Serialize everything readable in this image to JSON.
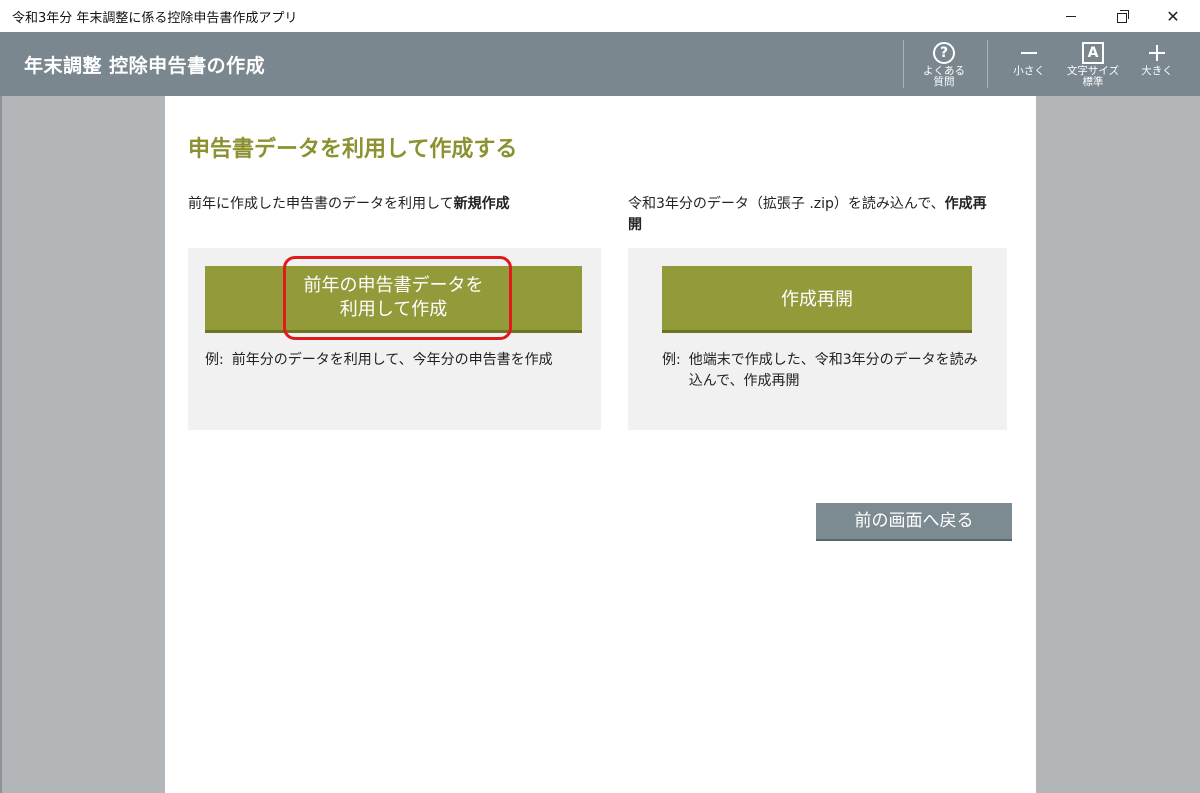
{
  "window": {
    "title": "令和3年分 年末調整に係る控除申告書作成アプリ"
  },
  "header": {
    "title": "年末調整 控除申告書の作成",
    "tools": {
      "faq_label_1": "よくある",
      "faq_label_2": "質問",
      "smaller_label": "小さく",
      "text_size_label_1": "文字サイズ",
      "text_size_label_2": "標準",
      "larger_label": "大きく",
      "text_size_glyph": "A",
      "faq_glyph": "?"
    }
  },
  "main": {
    "heading": "申告書データを利用して作成する",
    "left": {
      "description_prefix": "前年に作成した申告書のデータを利用して",
      "description_bold": "新規作成",
      "button_line1": "前年の申告書データを",
      "button_line2": "利用して作成",
      "example_label": "例:",
      "example_text": "前年分のデータを利用して、今年分の申告書を作成"
    },
    "right": {
      "description_prefix": "令和3年分のデータ（拡張子 .zip）を読み込んで、",
      "description_bold": "作成再開",
      "button_label": "作成再開",
      "example_label": "例:",
      "example_text": "他端末で作成した、令和3年分のデータを読み込んで、作成再開"
    },
    "back_button": "前の画面へ戻る"
  },
  "colors": {
    "accent_olive": "#939a3a",
    "heading_olive": "#8c9131",
    "header_gray": "#7a878f",
    "highlight_red": "#e01a1a"
  }
}
